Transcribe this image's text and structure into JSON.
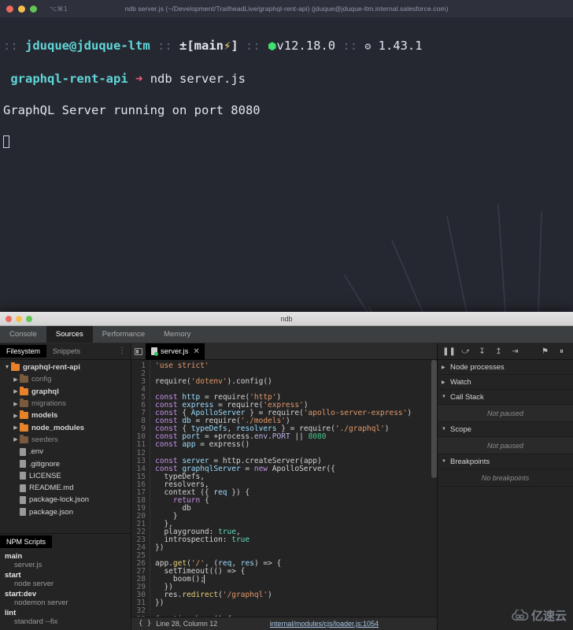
{
  "terminal": {
    "shortcut": "⌥⌘1",
    "title": "ndb server.js (~/Development/TrailheadLive/graphql-rent-api) (jduque@jduque-ltm.internal.salesforce.com)",
    "prompt": {
      "sep": "::",
      "user_host": "jduque@jduque-ltm",
      "git_branch": "±[main",
      "git_branch_close": "]",
      "lightning": "⚡",
      "node_version": "v12.18.0",
      "npm_version": "1.43.1",
      "hex_icon": "⬢",
      "gear_icon": "⚙"
    },
    "command_line": {
      "dir": "graphql-rent-api",
      "arrow": "➜",
      "command": "ndb server.js"
    },
    "output": "GraphQL Server running on port 8080"
  },
  "ndb": {
    "window_title": "ndb",
    "tabs": [
      {
        "label": "Console",
        "active": false
      },
      {
        "label": "Sources",
        "active": true
      },
      {
        "label": "Performance",
        "active": false
      },
      {
        "label": "Memory",
        "active": false
      }
    ],
    "more_icon": "⋮",
    "navigator": {
      "tabs": [
        {
          "label": "Filesystem",
          "active": true
        },
        {
          "label": "Snippets",
          "active": false
        }
      ],
      "tree": [
        {
          "label": "graphql-rent-api",
          "type": "folder",
          "depth": 0,
          "expanded": true,
          "dim": false,
          "bold": true
        },
        {
          "label": "config",
          "type": "folder",
          "depth": 1,
          "expanded": false,
          "dim": true,
          "bold": false
        },
        {
          "label": "graphql",
          "type": "folder",
          "depth": 1,
          "expanded": false,
          "dim": false,
          "bold": true
        },
        {
          "label": "migrations",
          "type": "folder",
          "depth": 1,
          "expanded": false,
          "dim": true,
          "bold": false
        },
        {
          "label": "models",
          "type": "folder",
          "depth": 1,
          "expanded": false,
          "dim": false,
          "bold": true
        },
        {
          "label": "node_modules",
          "type": "folder",
          "depth": 1,
          "expanded": false,
          "dim": false,
          "bold": true
        },
        {
          "label": "seeders",
          "type": "folder",
          "depth": 1,
          "expanded": false,
          "dim": true,
          "bold": false
        },
        {
          "label": ".env",
          "type": "file",
          "depth": 1,
          "expanded": false,
          "dim": false,
          "bold": false
        },
        {
          "label": ".gitignore",
          "type": "file",
          "depth": 1,
          "expanded": false,
          "dim": false,
          "bold": false
        },
        {
          "label": "LICENSE",
          "type": "file",
          "depth": 1,
          "expanded": false,
          "dim": false,
          "bold": false
        },
        {
          "label": "README.md",
          "type": "file",
          "depth": 1,
          "expanded": false,
          "dim": false,
          "bold": false
        },
        {
          "label": "package-lock.json",
          "type": "file",
          "depth": 1,
          "expanded": false,
          "dim": false,
          "bold": false
        },
        {
          "label": "package.json",
          "type": "file",
          "depth": 1,
          "expanded": false,
          "dim": false,
          "bold": false
        }
      ]
    },
    "npm_scripts": {
      "header": "NPM Scripts",
      "scripts": [
        {
          "name": "main",
          "cmd": "server.js"
        },
        {
          "name": "start",
          "cmd": "node server"
        },
        {
          "name": "start:dev",
          "cmd": "nodemon server"
        },
        {
          "name": "lint",
          "cmd": "standard --fix"
        }
      ]
    },
    "editor": {
      "open_tab": "server.js",
      "close_glyph": "✕",
      "lines": [
        {
          "n": 1,
          "tokens": [
            {
              "t": "'use strict'",
              "c": "c-str"
            }
          ]
        },
        {
          "n": 2,
          "tokens": []
        },
        {
          "n": 3,
          "tokens": [
            {
              "t": "require",
              "c": "c-plain"
            },
            {
              "t": "(",
              "c": "c-plain"
            },
            {
              "t": "'dotenv'",
              "c": "c-str"
            },
            {
              "t": ").",
              "c": "c-plain"
            },
            {
              "t": "config",
              "c": "c-plain"
            },
            {
              "t": "()",
              "c": "c-plain"
            }
          ]
        },
        {
          "n": 4,
          "tokens": []
        },
        {
          "n": 5,
          "tokens": [
            {
              "t": "const ",
              "c": "c-kw"
            },
            {
              "t": "http",
              "c": "c-var"
            },
            {
              "t": " = ",
              "c": "c-plain"
            },
            {
              "t": "require",
              "c": "c-plain"
            },
            {
              "t": "(",
              "c": "c-plain"
            },
            {
              "t": "'http'",
              "c": "c-str"
            },
            {
              "t": ")",
              "c": "c-plain"
            }
          ]
        },
        {
          "n": 6,
          "tokens": [
            {
              "t": "const ",
              "c": "c-kw"
            },
            {
              "t": "express",
              "c": "c-var"
            },
            {
              "t": " = ",
              "c": "c-plain"
            },
            {
              "t": "require",
              "c": "c-plain"
            },
            {
              "t": "(",
              "c": "c-plain"
            },
            {
              "t": "'express'",
              "c": "c-str"
            },
            {
              "t": ")",
              "c": "c-plain"
            }
          ]
        },
        {
          "n": 7,
          "tokens": [
            {
              "t": "const ",
              "c": "c-kw"
            },
            {
              "t": "{ ",
              "c": "c-plain"
            },
            {
              "t": "ApolloServer",
              "c": "c-var"
            },
            {
              "t": " } = ",
              "c": "c-plain"
            },
            {
              "t": "require",
              "c": "c-plain"
            },
            {
              "t": "(",
              "c": "c-plain"
            },
            {
              "t": "'apollo-server-express'",
              "c": "c-str"
            },
            {
              "t": ")",
              "c": "c-plain"
            }
          ]
        },
        {
          "n": 8,
          "tokens": [
            {
              "t": "const ",
              "c": "c-kw"
            },
            {
              "t": "db",
              "c": "c-var"
            },
            {
              "t": " = ",
              "c": "c-plain"
            },
            {
              "t": "require",
              "c": "c-plain"
            },
            {
              "t": "(",
              "c": "c-plain"
            },
            {
              "t": "'./models'",
              "c": "c-str"
            },
            {
              "t": ")",
              "c": "c-plain"
            }
          ]
        },
        {
          "n": 9,
          "tokens": [
            {
              "t": "const ",
              "c": "c-kw"
            },
            {
              "t": "{ ",
              "c": "c-plain"
            },
            {
              "t": "typeDefs",
              "c": "c-var"
            },
            {
              "t": ", ",
              "c": "c-plain"
            },
            {
              "t": "resolvers",
              "c": "c-var"
            },
            {
              "t": " } = ",
              "c": "c-plain"
            },
            {
              "t": "require",
              "c": "c-plain"
            },
            {
              "t": "(",
              "c": "c-plain"
            },
            {
              "t": "'./graphql'",
              "c": "c-str"
            },
            {
              "t": ")",
              "c": "c-plain"
            }
          ]
        },
        {
          "n": 10,
          "tokens": [
            {
              "t": "const ",
              "c": "c-kw"
            },
            {
              "t": "port",
              "c": "c-var"
            },
            {
              "t": " = +",
              "c": "c-plain"
            },
            {
              "t": "process",
              "c": "c-plain"
            },
            {
              "t": ".",
              "c": "c-plain"
            },
            {
              "t": "env",
              "c": "c-prop"
            },
            {
              "t": ".",
              "c": "c-plain"
            },
            {
              "t": "PORT",
              "c": "c-prop"
            },
            {
              "t": " || ",
              "c": "c-plain"
            },
            {
              "t": "8080",
              "c": "c-num"
            }
          ]
        },
        {
          "n": 11,
          "tokens": [
            {
              "t": "const ",
              "c": "c-kw"
            },
            {
              "t": "app",
              "c": "c-var"
            },
            {
              "t": " = ",
              "c": "c-plain"
            },
            {
              "t": "express",
              "c": "c-plain"
            },
            {
              "t": "()",
              "c": "c-plain"
            }
          ]
        },
        {
          "n": 12,
          "tokens": []
        },
        {
          "n": 13,
          "tokens": [
            {
              "t": "const ",
              "c": "c-kw"
            },
            {
              "t": "server",
              "c": "c-var"
            },
            {
              "t": " = ",
              "c": "c-plain"
            },
            {
              "t": "http",
              "c": "c-plain"
            },
            {
              "t": ".",
              "c": "c-plain"
            },
            {
              "t": "createServer",
              "c": "c-plain"
            },
            {
              "t": "(",
              "c": "c-plain"
            },
            {
              "t": "app",
              "c": "c-plain"
            },
            {
              "t": ")",
              "c": "c-plain"
            }
          ]
        },
        {
          "n": 14,
          "tokens": [
            {
              "t": "const ",
              "c": "c-kw"
            },
            {
              "t": "graphqlServer",
              "c": "c-var"
            },
            {
              "t": " = ",
              "c": "c-plain"
            },
            {
              "t": "new ",
              "c": "c-kw"
            },
            {
              "t": "ApolloServer",
              "c": "c-plain"
            },
            {
              "t": "({",
              "c": "c-plain"
            }
          ]
        },
        {
          "n": 15,
          "tokens": [
            {
              "t": "  typeDefs,",
              "c": "c-plain"
            }
          ]
        },
        {
          "n": 16,
          "tokens": [
            {
              "t": "  resolvers,",
              "c": "c-plain"
            }
          ]
        },
        {
          "n": 17,
          "tokens": [
            {
              "t": "  context ({ ",
              "c": "c-plain"
            },
            {
              "t": "req",
              "c": "c-var"
            },
            {
              "t": " }) {",
              "c": "c-plain"
            }
          ]
        },
        {
          "n": 18,
          "tokens": [
            {
              "t": "    ",
              "c": "c-plain"
            },
            {
              "t": "return",
              "c": "c-kw"
            },
            {
              "t": " {",
              "c": "c-plain"
            }
          ]
        },
        {
          "n": 19,
          "tokens": [
            {
              "t": "      db",
              "c": "c-plain"
            }
          ]
        },
        {
          "n": 20,
          "tokens": [
            {
              "t": "    }",
              "c": "c-plain"
            }
          ]
        },
        {
          "n": 21,
          "tokens": [
            {
              "t": "  },",
              "c": "c-plain"
            }
          ]
        },
        {
          "n": 22,
          "tokens": [
            {
              "t": "  playground: ",
              "c": "c-plain"
            },
            {
              "t": "true",
              "c": "c-lit"
            },
            {
              "t": ",",
              "c": "c-plain"
            }
          ]
        },
        {
          "n": 23,
          "tokens": [
            {
              "t": "  introspection: ",
              "c": "c-plain"
            },
            {
              "t": "true",
              "c": "c-lit"
            }
          ]
        },
        {
          "n": 24,
          "tokens": [
            {
              "t": "})",
              "c": "c-plain"
            }
          ]
        },
        {
          "n": 25,
          "tokens": []
        },
        {
          "n": 26,
          "tokens": [
            {
              "t": "app",
              "c": "c-plain"
            },
            {
              "t": ".",
              "c": "c-plain"
            },
            {
              "t": "get",
              "c": "c-fn"
            },
            {
              "t": "(",
              "c": "c-plain"
            },
            {
              "t": "'/'",
              "c": "c-str"
            },
            {
              "t": ", (",
              "c": "c-plain"
            },
            {
              "t": "req",
              "c": "c-var"
            },
            {
              "t": ", ",
              "c": "c-plain"
            },
            {
              "t": "res",
              "c": "c-var"
            },
            {
              "t": ") => {",
              "c": "c-plain"
            }
          ]
        },
        {
          "n": 27,
          "tokens": [
            {
              "t": "  setTimeout(() => {",
              "c": "c-plain"
            }
          ]
        },
        {
          "n": 28,
          "tokens": [
            {
              "t": "    boom();",
              "c": "c-plain"
            },
            {
              "t": "",
              "c": "c-cursor"
            }
          ]
        },
        {
          "n": 29,
          "tokens": [
            {
              "t": "  })",
              "c": "c-plain"
            }
          ]
        },
        {
          "n": 30,
          "tokens": [
            {
              "t": "  res",
              "c": "c-plain"
            },
            {
              "t": ".",
              "c": "c-plain"
            },
            {
              "t": "redirect",
              "c": "c-fn"
            },
            {
              "t": "(",
              "c": "c-plain"
            },
            {
              "t": "'/graphql'",
              "c": "c-str"
            },
            {
              "t": ")",
              "c": "c-plain"
            }
          ]
        },
        {
          "n": 31,
          "tokens": [
            {
              "t": "})",
              "c": "c-plain"
            }
          ]
        },
        {
          "n": 32,
          "tokens": []
        },
        {
          "n": 33,
          "tokens": [
            {
              "t": "function ",
              "c": "c-kw"
            },
            {
              "t": "boom",
              "c": "c-fn"
            },
            {
              "t": "() {",
              "c": "c-plain"
            }
          ]
        }
      ]
    },
    "status": {
      "braces_icon": "{ }",
      "position": "Line 28, Column 12",
      "link": "internal/modules/cjs/loader.js:1054"
    },
    "debugger": {
      "toolbar": [
        {
          "name": "resume-pause-button",
          "glyph": "❚❚"
        },
        {
          "name": "step-over-button",
          "glyph": "⤻"
        },
        {
          "name": "step-into-button",
          "glyph": "↧"
        },
        {
          "name": "step-out-button",
          "glyph": "↥"
        },
        {
          "name": "step-button",
          "glyph": "⇥"
        },
        {
          "name": "deactivate-breakpoints-button",
          "glyph": "⚑"
        },
        {
          "name": "pause-on-exceptions-button",
          "glyph": "⏸"
        }
      ],
      "sections": [
        {
          "title": "Node processes",
          "expanded": false,
          "empty": null
        },
        {
          "title": "Watch",
          "expanded": false,
          "empty": null
        },
        {
          "title": "Call Stack",
          "expanded": true,
          "empty": "Not paused"
        },
        {
          "title": "Scope",
          "expanded": true,
          "empty": "Not paused"
        },
        {
          "title": "Breakpoints",
          "expanded": true,
          "empty": "No breakpoints"
        }
      ]
    }
  },
  "watermark": {
    "text": "亿速云"
  },
  "colors": {
    "terminal_bg": "#262831",
    "accent_orange": "#e8822a",
    "accent_green": "#3ee06e",
    "devtools_bg": "#242424"
  }
}
